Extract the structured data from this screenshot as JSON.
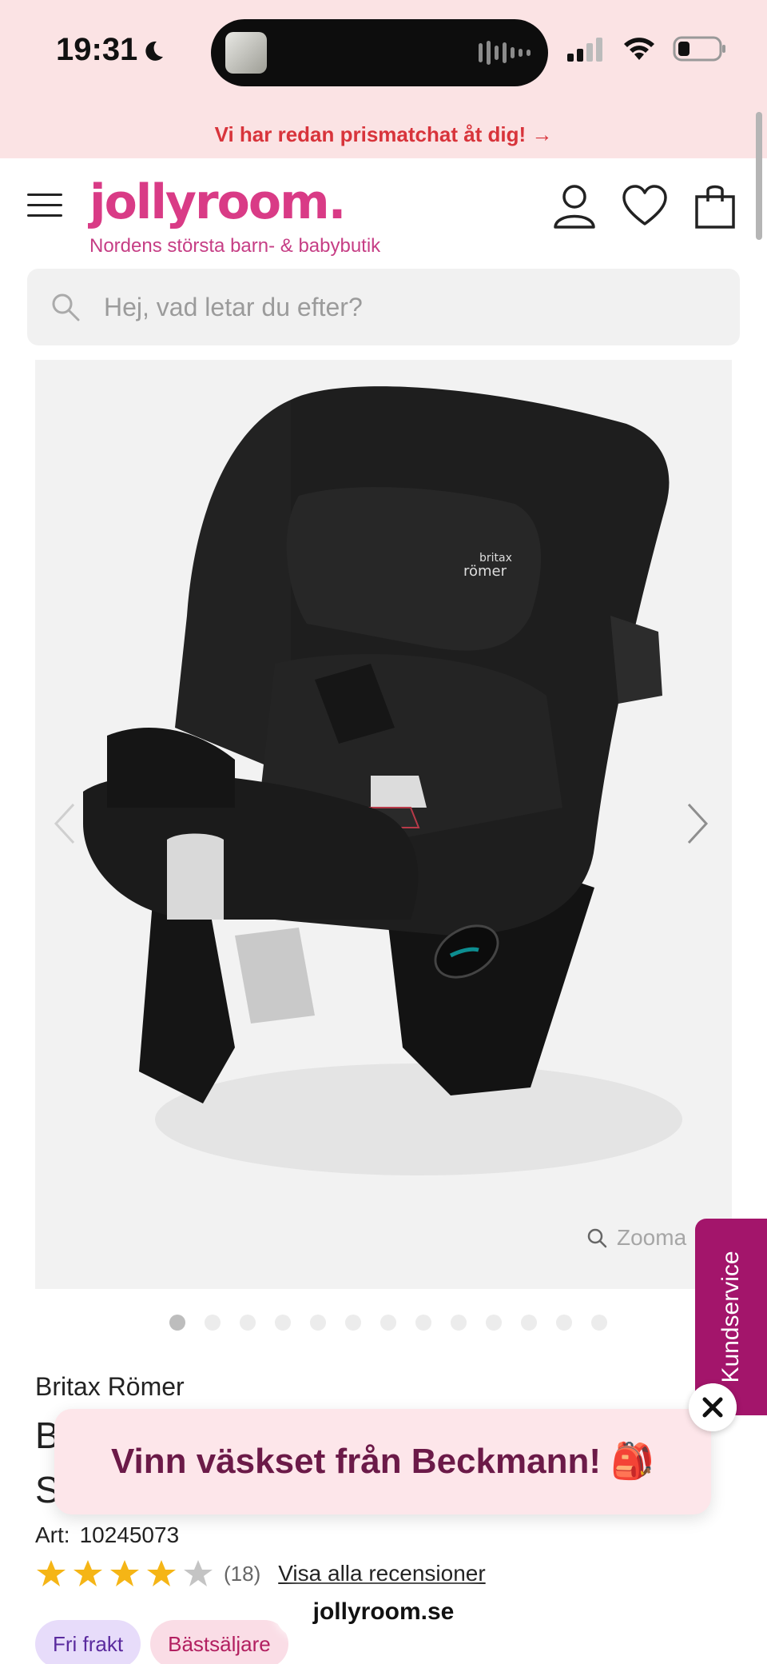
{
  "status_bar": {
    "time": "19:31"
  },
  "promo_banner": {
    "text": "Vi har redan prismatchat åt dig! →"
  },
  "header": {
    "logo": "jollyroom.",
    "tagline": "Nordens största barn- & babybutik"
  },
  "search": {
    "placeholder": "Hej, vad letar du efter?"
  },
  "gallery": {
    "zoom_label": "Zooma",
    "total_images": 13,
    "active_index": 0,
    "colors": {
      "seat": "#1c1c1c",
      "accent_silver": "#d9d9d9"
    }
  },
  "kundservice": {
    "label": "Kundservice"
  },
  "product": {
    "brand": "Britax Römer",
    "name_line1_visible": "B",
    "name_line2_visible": "S",
    "art_label": "Art:",
    "art_number": "10245073",
    "rating": 4,
    "rating_max": 5,
    "review_count": "(18)",
    "reviews_link": "Visa alla recensioner",
    "badges": [
      "Fri frakt",
      "Bästsäljare"
    ]
  },
  "popup": {
    "text": "Vinn väskset från Beckmann! 🎒"
  },
  "browser": {
    "url": "jollyroom.se"
  },
  "colors": {
    "brand_pink": "#d93b86",
    "promo_bg": "#fbe3e4",
    "promo_text": "#d8343b",
    "kundservice_bg": "#a3156b",
    "star": "#f5b516"
  }
}
